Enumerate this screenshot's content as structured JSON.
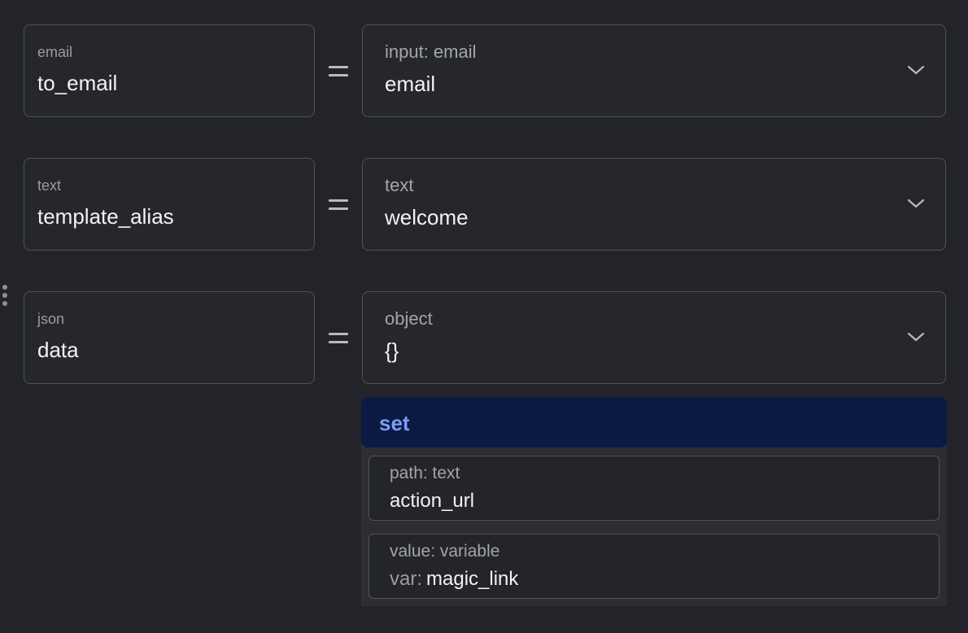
{
  "rows": [
    {
      "param_type": "email",
      "param_name": "to_email",
      "source_label": "input: email",
      "source_value": "email"
    },
    {
      "param_type": "text",
      "param_name": "template_alias",
      "source_label": "text",
      "source_value": "welcome"
    },
    {
      "param_type": "json",
      "param_name": "data",
      "source_label": "object",
      "source_value": "{}"
    }
  ],
  "set_panel": {
    "title": "set",
    "path_label": "path: text",
    "path_value": "action_url",
    "value_label": "value: variable",
    "var_prefix": "var:",
    "var_value": "magic_link"
  },
  "icons": {
    "dropdown": "chevron-down-icon",
    "equals": "equals-icon",
    "drag": "drag-handle-icon"
  },
  "colors": {
    "background": "#222429",
    "border": "#4f5259",
    "set_header_bg": "#0b1a42",
    "set_header_text": "#7b9cf2"
  }
}
